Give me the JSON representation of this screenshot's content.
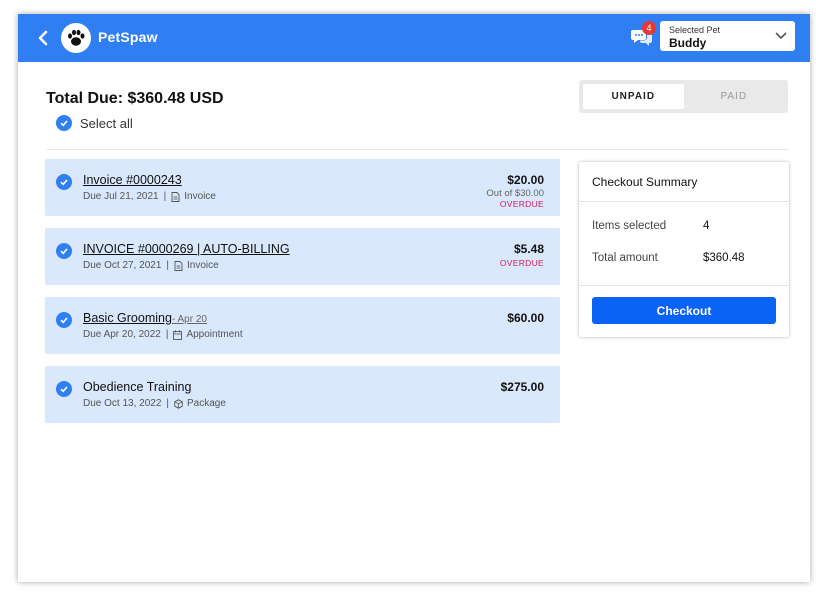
{
  "header": {
    "app_name": "PetSpaw",
    "notification_count": "4",
    "pet_select": {
      "label": "Selected Pet",
      "value": "Buddy"
    }
  },
  "summary_top": {
    "total_due": "Total Due: $360.48 USD",
    "select_all_label": "Select all"
  },
  "tabs": [
    {
      "label": "UNPAID",
      "active": true
    },
    {
      "label": "PAID",
      "active": false
    }
  ],
  "items": [
    {
      "title": "Invoice #0000243",
      "title_suffix": "",
      "due": "Due Jul 21, 2021",
      "type": "Invoice",
      "type_icon": "document-icon",
      "amount": "$20.00",
      "out_of": "Out of $30.00",
      "status": "OVERDUE",
      "linked": true
    },
    {
      "title": "INVOICE #0000269 | AUTO-BILLING",
      "title_suffix": "",
      "due": "Due Oct 27, 2021",
      "type": "Invoice",
      "type_icon": "document-icon",
      "amount": "$5.48",
      "out_of": "",
      "status": "OVERDUE",
      "linked": true
    },
    {
      "title": "Basic Grooming",
      "title_suffix": "- Apr 20",
      "due": "Due Apr 20, 2022",
      "type": "Appointment",
      "type_icon": "calendar-icon",
      "amount": "$60.00",
      "out_of": "",
      "status": "",
      "linked": true
    },
    {
      "title": "Obedience Training",
      "title_suffix": "",
      "due": "Due Oct 13, 2022",
      "type": "Package",
      "type_icon": "package-icon",
      "amount": "$275.00",
      "out_of": "",
      "status": "",
      "linked": false
    }
  ],
  "checkout": {
    "title": "Checkout Summary",
    "items_selected_label": "Items selected",
    "items_selected_value": "4",
    "total_amount_label": "Total amount",
    "total_amount_value": "$360.48",
    "button_label": "Checkout"
  },
  "colors": {
    "header_bg": "#2f7ff2",
    "item_bg": "#d9e8fc",
    "accent": "#0b63f6",
    "overdue": "#d81b60"
  }
}
